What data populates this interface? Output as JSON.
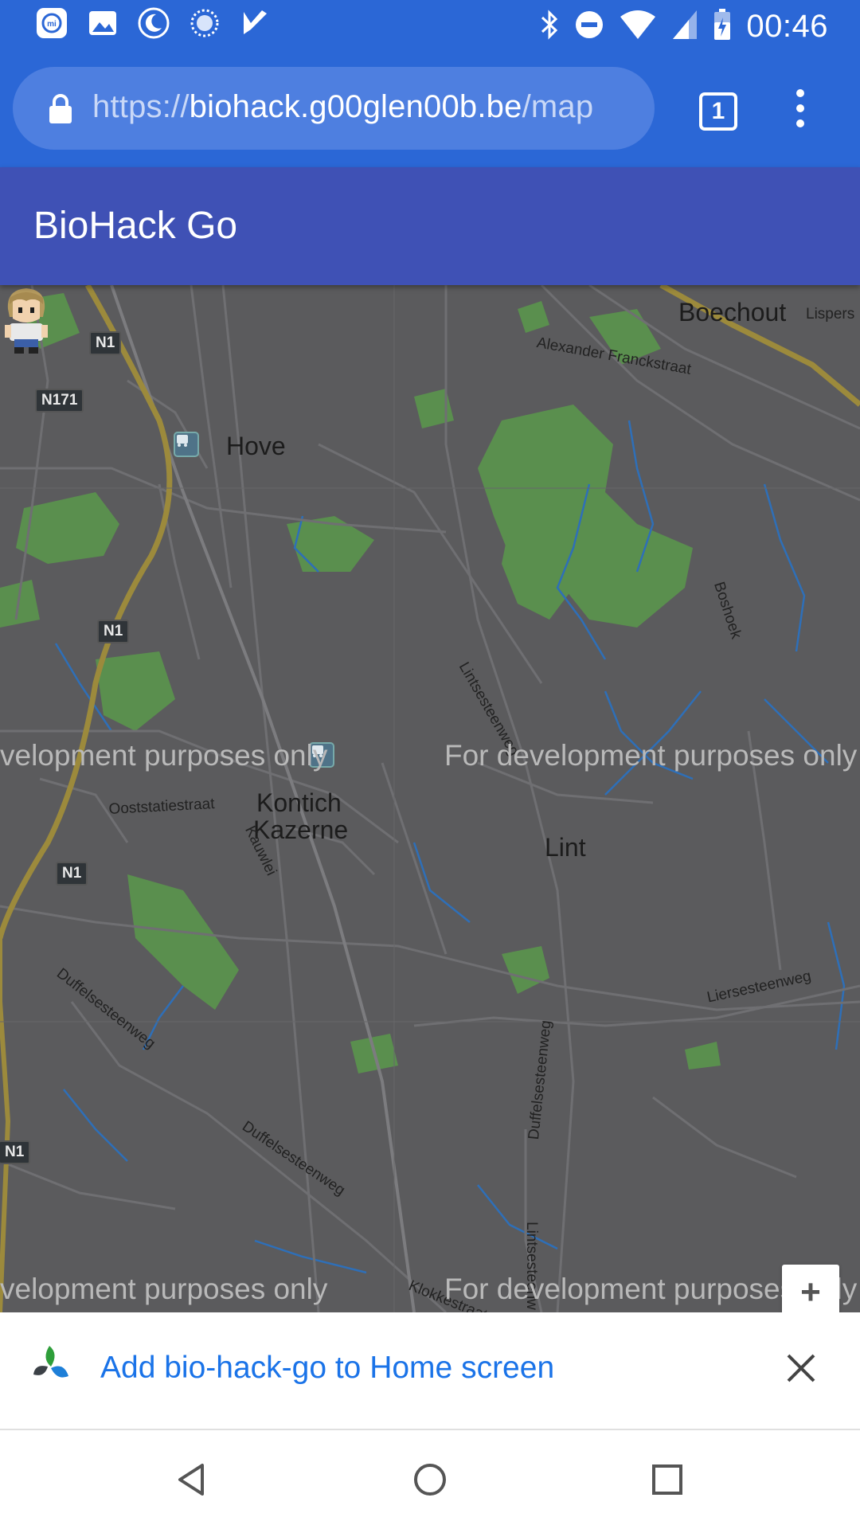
{
  "status_bar": {
    "time": "00:46",
    "left_icons": [
      "mi-icon",
      "gallery-icon",
      "moon-icon",
      "sync-icon",
      "check-icon"
    ],
    "right_icons": [
      "bluetooth-icon",
      "do-not-disturb-icon",
      "wifi-icon",
      "signal-icon",
      "battery-icon"
    ]
  },
  "browser": {
    "url_prefix": "https://",
    "url_host": "biohack.g00glen00b.be",
    "url_path": "/map",
    "tab_count": "1"
  },
  "app": {
    "title": "BioHack Go"
  },
  "map": {
    "places": {
      "boechout": "Boechout",
      "hove": "Hove",
      "kontich_1": "Kontich",
      "kontich_2": "Kazerne",
      "lint": "Lint",
      "lispers": "Lispers"
    },
    "streets": {
      "alexander": "Alexander Franckstraat",
      "boshoek": "Boshoek",
      "lintsesteenweg": "Lintsesteenweg",
      "ooststatiestraat": "Ooststatiestraat",
      "kauwlei": "Kauwlei",
      "duffelsesteenweg_1": "Duffelsesteenweg",
      "duffelsesteenweg_2": "Duffelsesteenweg",
      "duffelsesteenweg_3": "Duffelsesteenweg",
      "liersesteenweg": "Liersesteenweg",
      "lintsesteenweg_2": "Lintsesteenw",
      "klokkestraat": "Klokkestraat"
    },
    "roads": {
      "n1_a": "N1",
      "n171": "N171",
      "n1_b": "N1",
      "n1_c": "N1",
      "n1_d": "N1"
    },
    "watermarks": {
      "w1": "velopment purposes only",
      "w2": "For development purposes only",
      "w3": "velopment purposes only",
      "w4": "For development purposes only"
    },
    "zoom_in_label": "+"
  },
  "install_banner": {
    "text": "Add bio-hack-go to Home screen"
  },
  "colors": {
    "status_bar": "#2b67d6",
    "app_bar": "#3f51b5",
    "map_bg": "#5b5b5d",
    "park": "#5a8f4e",
    "banner_text": "#1a73e8"
  }
}
